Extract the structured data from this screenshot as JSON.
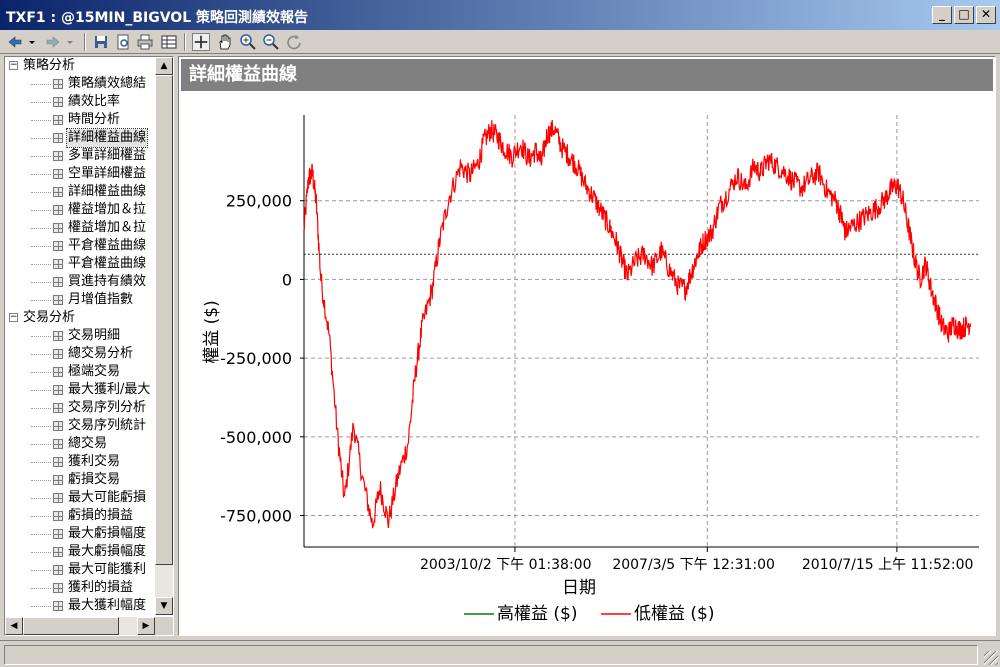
{
  "window": {
    "title": "TXF1 : @15MIN_BIGVOL 策略回測績效報告",
    "minimize": "_",
    "maximize": "□",
    "close": "✕"
  },
  "toolbar": {
    "icons": [
      "back-arrow-icon",
      "dropdown-icon",
      "forward-arrow-icon",
      "dropdown-icon",
      "save-icon",
      "preview-icon",
      "print-icon",
      "table-icon",
      "crosshair-icon",
      "hand-pan-icon",
      "zoom-in-icon",
      "zoom-out-icon",
      "refresh-icon"
    ]
  },
  "tree": {
    "groups": [
      {
        "label": "策略分析",
        "toggle": "−",
        "items": [
          "策略績效總結",
          "績效比率",
          "時間分析",
          "詳細權益曲線",
          "多單詳細權益",
          "空單詳細權益",
          "詳細權益曲線",
          "權益增加＆拉",
          "權益增加＆拉",
          "平倉權益曲線",
          "平倉權益曲線",
          "買進持有績效",
          "月增值指數"
        ]
      },
      {
        "label": "交易分析",
        "toggle": "−",
        "items": [
          "交易明細",
          "總交易分析",
          "極端交易",
          "最大獲利/最大",
          "交易序列分析",
          "交易序列統計",
          "總交易",
          "獲利交易",
          "虧損交易",
          "最大可能虧損",
          "虧損的損益",
          "最大虧損幅度",
          "最大虧損幅度",
          "最大可能獲利",
          "獲利的損益",
          "最大獲利幅度"
        ]
      }
    ],
    "selected_item": "詳細權益曲線"
  },
  "panel": {
    "header": "詳細權益曲線"
  },
  "chart_data": {
    "type": "line",
    "title": "",
    "xlabel": "日期",
    "ylabel": "權益 ($)",
    "ylim": [
      -850000,
      500000
    ],
    "y_ticks": [
      250000,
      0,
      -250000,
      -500000,
      -750000
    ],
    "y_tick_labels": [
      "250,000",
      "0",
      "-250,000",
      "-500,000",
      "-750,000"
    ],
    "x_tick_labels": [
      "2003/10/2 下午 01:38:00",
      "2007/3/5 下午 12:31:00",
      "2010/7/15 上午 11:52:00"
    ],
    "x_tick_years": [
      2003.75,
      2007.17,
      2010.54
    ],
    "reference_line_y": 80000,
    "grid": true,
    "legend_position": "bottom",
    "series": [
      {
        "name": "高權益 ($)",
        "color": "#008000",
        "points": []
      },
      {
        "name": "低權益 ($)",
        "color": "#ff0000",
        "points": [
          [
            2000.0,
            160000
          ],
          [
            2000.08,
            320000
          ],
          [
            2000.15,
            340000
          ],
          [
            2000.22,
            240000
          ],
          [
            2000.3,
            0
          ],
          [
            2000.45,
            -180000
          ],
          [
            2000.6,
            -500000
          ],
          [
            2000.72,
            -700000
          ],
          [
            2000.88,
            -460000
          ],
          [
            2001.05,
            -640000
          ],
          [
            2001.22,
            -780000
          ],
          [
            2001.35,
            -660000
          ],
          [
            2001.5,
            -770000
          ],
          [
            2001.68,
            -620000
          ],
          [
            2001.85,
            -520000
          ],
          [
            2001.98,
            -300000
          ],
          [
            2002.1,
            -150000
          ],
          [
            2002.28,
            -30000
          ],
          [
            2002.42,
            130000
          ],
          [
            2002.58,
            260000
          ],
          [
            2002.78,
            360000
          ],
          [
            2002.95,
            330000
          ],
          [
            2003.1,
            370000
          ],
          [
            2003.2,
            440000
          ],
          [
            2003.32,
            475000
          ],
          [
            2003.45,
            450000
          ],
          [
            2003.55,
            420000
          ],
          [
            2003.7,
            390000
          ],
          [
            2003.85,
            430000
          ],
          [
            2004.0,
            380000
          ],
          [
            2004.12,
            410000
          ],
          [
            2004.22,
            370000
          ],
          [
            2004.32,
            460000
          ],
          [
            2004.45,
            480000
          ],
          [
            2004.58,
            420000
          ],
          [
            2004.72,
            390000
          ],
          [
            2004.85,
            360000
          ],
          [
            2005.0,
            300000
          ],
          [
            2005.15,
            260000
          ],
          [
            2005.3,
            210000
          ],
          [
            2005.42,
            170000
          ],
          [
            2005.55,
            120000
          ],
          [
            2005.65,
            60000
          ],
          [
            2005.75,
            10000
          ],
          [
            2005.9,
            60000
          ],
          [
            2006.05,
            80000
          ],
          [
            2006.2,
            40000
          ],
          [
            2006.35,
            90000
          ],
          [
            2006.5,
            30000
          ],
          [
            2006.65,
            -20000
          ],
          [
            2006.78,
            -30000
          ],
          [
            2006.9,
            30000
          ],
          [
            2007.0,
            80000
          ],
          [
            2007.1,
            120000
          ],
          [
            2007.25,
            150000
          ],
          [
            2007.38,
            230000
          ],
          [
            2007.52,
            270000
          ],
          [
            2007.7,
            330000
          ],
          [
            2007.85,
            290000
          ],
          [
            2008.0,
            360000
          ],
          [
            2008.12,
            340000
          ],
          [
            2008.25,
            380000
          ],
          [
            2008.4,
            360000
          ],
          [
            2008.55,
            340000
          ],
          [
            2008.7,
            310000
          ],
          [
            2008.85,
            290000
          ],
          [
            2009.0,
            320000
          ],
          [
            2009.15,
            340000
          ],
          [
            2009.3,
            280000
          ],
          [
            2009.45,
            250000
          ],
          [
            2009.55,
            200000
          ],
          [
            2009.62,
            150000
          ],
          [
            2009.75,
            170000
          ],
          [
            2009.9,
            190000
          ],
          [
            2010.05,
            210000
          ],
          [
            2010.2,
            230000
          ],
          [
            2010.35,
            260000
          ],
          [
            2010.45,
            290000
          ],
          [
            2010.55,
            300000
          ],
          [
            2010.65,
            250000
          ],
          [
            2010.75,
            160000
          ],
          [
            2010.85,
            70000
          ],
          [
            2010.95,
            0
          ],
          [
            2011.05,
            50000
          ],
          [
            2011.15,
            -30000
          ],
          [
            2011.25,
            -90000
          ],
          [
            2011.35,
            -150000
          ],
          [
            2011.45,
            -170000
          ],
          [
            2011.55,
            -140000
          ],
          [
            2011.65,
            -160000
          ],
          [
            2011.75,
            -150000
          ],
          [
            2011.85,
            -140000
          ]
        ]
      }
    ]
  }
}
